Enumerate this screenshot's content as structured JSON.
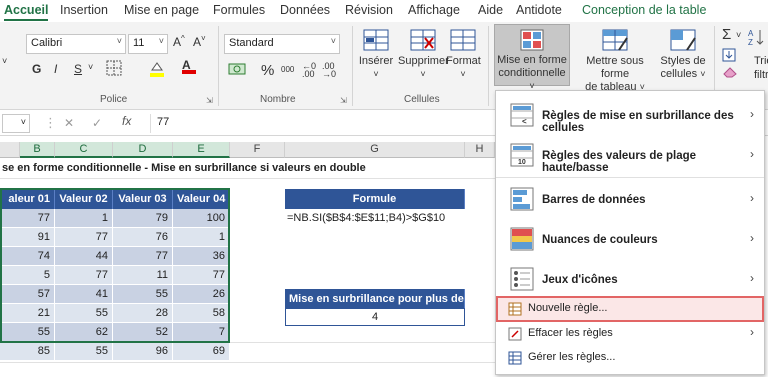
{
  "tabs": [
    "Accueil",
    "Insertion",
    "Mise en page",
    "Formules",
    "Données",
    "Révision",
    "Affichage",
    "Aide",
    "Antidote",
    "Conception de la table"
  ],
  "ribbon": {
    "font_name": "Calibri",
    "font_size": "11",
    "grow_font": "A^",
    "shrink_font": "A˅",
    "bold": "G",
    "italic": "I",
    "underline": "S",
    "group_police": "Police",
    "number_format": "Standard",
    "percent": "%",
    "thousands": "000",
    "group_nombre": "Nombre",
    "insert": "Insérer",
    "delete": "Supprimer",
    "format": "Format",
    "group_cellules": "Cellules",
    "cond_format": "Mise en forme conditionnelle ˅",
    "cond_format_l1": "Mise en forme",
    "cond_format_l2": "conditionnelle",
    "table_format_l1": "Mettre sous forme",
    "table_format_l2": "de tableau",
    "cell_styles_l1": "Styles de",
    "cell_styles_l2": "cellules",
    "sigma": "Σ",
    "sort_l1": "Trie",
    "sort_l2": "filtr"
  },
  "formula_bar": {
    "name_box": "",
    "cancel": "✕",
    "confirm": "✓",
    "fx": "fx",
    "value": "77"
  },
  "columns": [
    "B",
    "C",
    "D",
    "E",
    "F",
    "G",
    "H"
  ],
  "sheet": {
    "title": "se en forme conditionnelle - Mise en surbrillance si valeurs en double",
    "table_headers": [
      "aleur 01",
      "Valeur 02",
      "Valeur 03",
      "Valeur 04"
    ],
    "rows": [
      [
        "77",
        "1",
        "79",
        "100"
      ],
      [
        "91",
        "77",
        "76",
        "1"
      ],
      [
        "74",
        "44",
        "77",
        "36"
      ],
      [
        "5",
        "77",
        "11",
        "77"
      ],
      [
        "57",
        "41",
        "55",
        "26"
      ],
      [
        "21",
        "55",
        "28",
        "58"
      ],
      [
        "55",
        "62",
        "52",
        "7"
      ],
      [
        "85",
        "55",
        "96",
        "69"
      ]
    ],
    "formula_header": "Formule",
    "formula_text": "=NB.SI($B$4:$E$11;B4)>$G$10",
    "threshold_header": "Mise en surbrillance pour plus de",
    "threshold_value": "4"
  },
  "menu": {
    "items": [
      {
        "label": "Règles de mise en surbrillance des cellules",
        "has_sub": true
      },
      {
        "label": "Règles des valeurs de plage haute/basse",
        "has_sub": true
      },
      {
        "label": "Barres de données",
        "has_sub": true
      },
      {
        "label": "Nuances de couleurs",
        "has_sub": true
      },
      {
        "label": "Jeux d'icônes",
        "has_sub": true
      },
      {
        "label": "Nouvelle règle...",
        "has_sub": false
      },
      {
        "label": "Effacer les règles",
        "has_sub": true
      },
      {
        "label": "Gérer les règles...",
        "has_sub": false
      }
    ],
    "arrow": "›"
  },
  "colors": {
    "accent_green": "#217346",
    "table_header_blue": "#2f5597",
    "highlight_red": "#e26565"
  }
}
